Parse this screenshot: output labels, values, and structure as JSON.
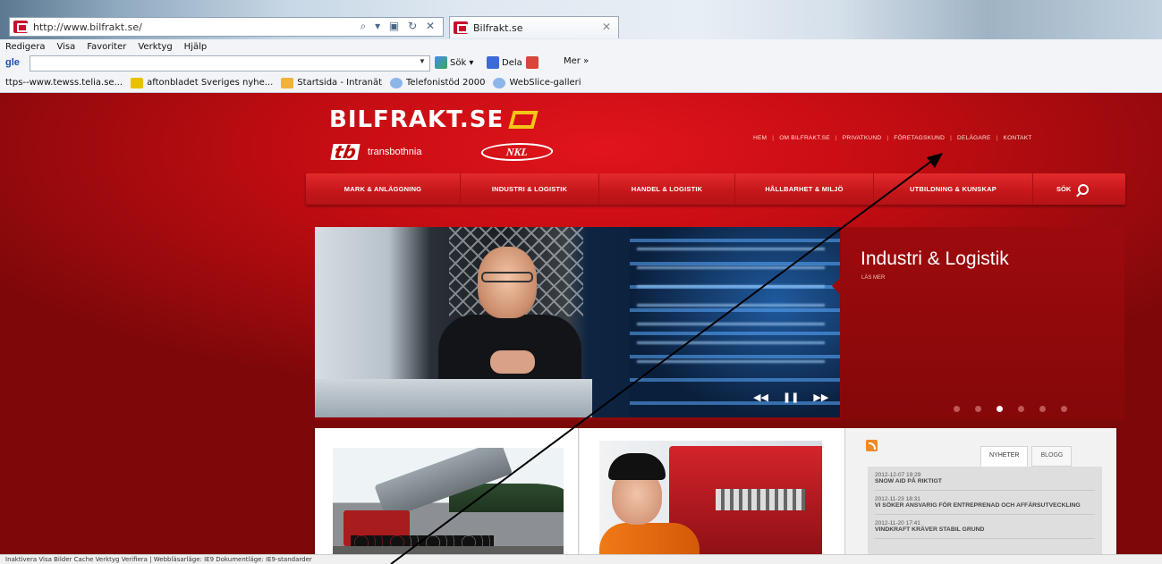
{
  "browser": {
    "url": "http://www.bilfrakt.se/",
    "address_tools": "⌕ ▾ ▣ ↻ ✕",
    "tab_title": "Bilfrakt.se",
    "tab_close": "✕",
    "menu": [
      "Redigera",
      "Visa",
      "Favoriter",
      "Verktyg",
      "Hjälp"
    ],
    "google": {
      "logo": "gle",
      "dropdown": "▼",
      "search_label": "Sök ▾",
      "share_label": "Dela",
      "more_label": "Mer »"
    },
    "favorites": [
      {
        "label": "ttps--www.tewss.telia.se...",
        "icon": "none"
      },
      {
        "label": "aftonbladet Sveriges nyhe...",
        "icon": "news-icon"
      },
      {
        "label": "Startsida - Intranät",
        "icon": "folder-icon"
      },
      {
        "label": "Telefonistöd 2000",
        "icon": "ie-icon"
      },
      {
        "label": "WebSlice-galleri",
        "icon": "ie-icon"
      }
    ],
    "statusbar": "Inaktivera   Visa   Bilder   Cache   Verktyg   Verifiera  |  Webbläsarläge: IE9   Dokumentläge: IE9-standarder"
  },
  "site": {
    "logo_text": "BILFRAKT.SE",
    "tb_mark": "tb",
    "tb_text": "transbothnia",
    "nkl_text": "NKL",
    "top_nav": [
      "HEM",
      "OM BILFRAKT.SE",
      "PRIVATKUND",
      "FÖRETAGSKUND",
      "DELÄGARE",
      "KONTAKT"
    ],
    "top_nav_separator": "|",
    "main_nav": [
      "MARK & ANLÄGGNING",
      "INDUSTRI & LOGISTIK",
      "HANDEL & LOGISTIK",
      "HÅLLBARHET & MILJÖ",
      "UTBILDNING & KUNSKAP"
    ],
    "main_nav_search": "SÖK",
    "hero": {
      "heading": "Industri & Logistik",
      "read_more": "LÄS MER",
      "controls": {
        "prev": "◀◀",
        "pause": "❚❚",
        "next": "▶▶"
      },
      "slide_count": 6,
      "active_slide": 3
    },
    "news": {
      "tabs": [
        "NYHETER",
        "BLOGG"
      ],
      "active_tab": "NYHETER",
      "items": [
        {
          "date": "2012-12-07 19:29",
          "title": "SNOW AID PÅ RIKTIGT"
        },
        {
          "date": "2012-11-23 18:31",
          "title": "VI SÖKER ANSVARIG FÖR ENTREPRENAD OCH AFFÄRSUTVECKLING"
        },
        {
          "date": "2012-11-20 17:41",
          "title": "VINDKRAFT KRÄVER STABIL GRUND"
        }
      ]
    }
  },
  "colors": {
    "page_red": "#c60d13",
    "nav_red": "#c4161a",
    "logo_accent": "#f5c518",
    "annotation": "#000000"
  }
}
